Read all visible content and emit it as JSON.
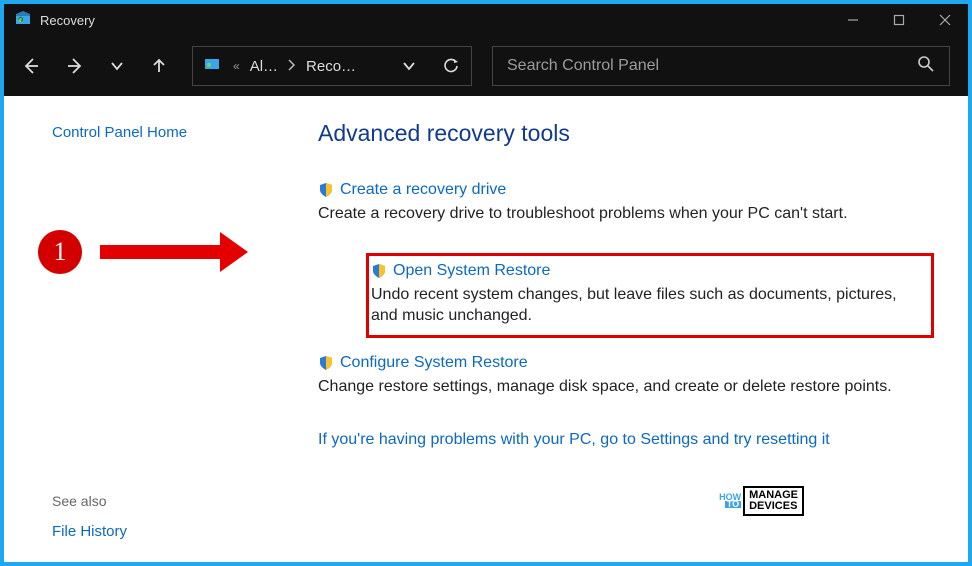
{
  "window": {
    "title": "Recovery"
  },
  "breadcrumb": {
    "seg1": "Al…",
    "seg2": "Reco…"
  },
  "search": {
    "placeholder": "Search Control Panel"
  },
  "sidebar": {
    "home": "Control Panel Home",
    "see_also": "See also",
    "file_history": "File History"
  },
  "main": {
    "heading": "Advanced recovery tools",
    "tools": [
      {
        "title": "Create a recovery drive",
        "desc": "Create a recovery drive to troubleshoot problems when your PC can't start."
      },
      {
        "title": "Open System Restore",
        "desc": "Undo recent system changes, but leave files such as documents, pictures, and music unchanged."
      },
      {
        "title": "Configure System Restore",
        "desc": "Change restore settings, manage disk space, and create or delete restore points."
      }
    ],
    "settings_link": "If you're having problems with your PC, go to Settings and try resetting it"
  },
  "callout": {
    "num": "1"
  },
  "logo": {
    "how": "HOW",
    "to": "TO",
    "line1": "MANAGE",
    "line2": "DEVICES"
  },
  "help": "?"
}
